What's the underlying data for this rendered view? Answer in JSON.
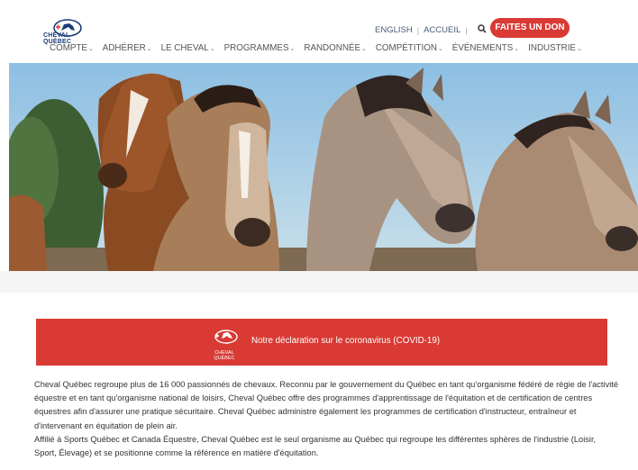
{
  "brand": {
    "logo_text_line1": "CHEVAL",
    "logo_text_line2": "QUÉBEC"
  },
  "topbar": {
    "english": "ENGLISH",
    "separator": "|",
    "home": "ACCUEIL",
    "search_glyph": "🔍",
    "donate": "FAITES UN DON"
  },
  "nav": {
    "items": [
      {
        "label": "COMPTE"
      },
      {
        "label": "ADHÉRER"
      },
      {
        "label": "LE CHEVAL"
      },
      {
        "label": "PROGRAMMES"
      },
      {
        "label": "RANDONNÉE"
      },
      {
        "label": "COMPÉTITION"
      },
      {
        "label": "ÉVÉNEMENTS"
      },
      {
        "label": "INDUSTRIE"
      }
    ],
    "chevron": "⌄"
  },
  "banner": {
    "text": "Notre déclaration sur le coronavirus (COVID-19)",
    "logo_line1": "CHEVAL",
    "logo_line2": "QUÉBEC"
  },
  "content": {
    "paragraph1": "Cheval Québec regroupe plus de 16 000 passionnés de chevaux. Reconnu par le gouvernement du Québec en tant qu'organisme fédéré de régie de l'activité équestre et en tant qu'organisme national de loisirs, Cheval Québec offre des programmes d'apprentissage de l'équitation et de certification de centres équestres afin d'assurer une pratique sécuritaire. Cheval Québec administre également les programmes de certification d'instructeur, entraîneur et d'intervenant en équitation de plein air.",
    "paragraph2": "Affilié à Sports Québec et Canada Équestre, Cheval Québec est le seul organisme au Québec qui regroupe les différentes sphères de l'industrie (Loisir, Sport, Élevage) et se positionne comme la référence en matière d'équitation."
  },
  "colors": {
    "accent": "#d93a34",
    "brand_blue": "#1b3a78"
  }
}
